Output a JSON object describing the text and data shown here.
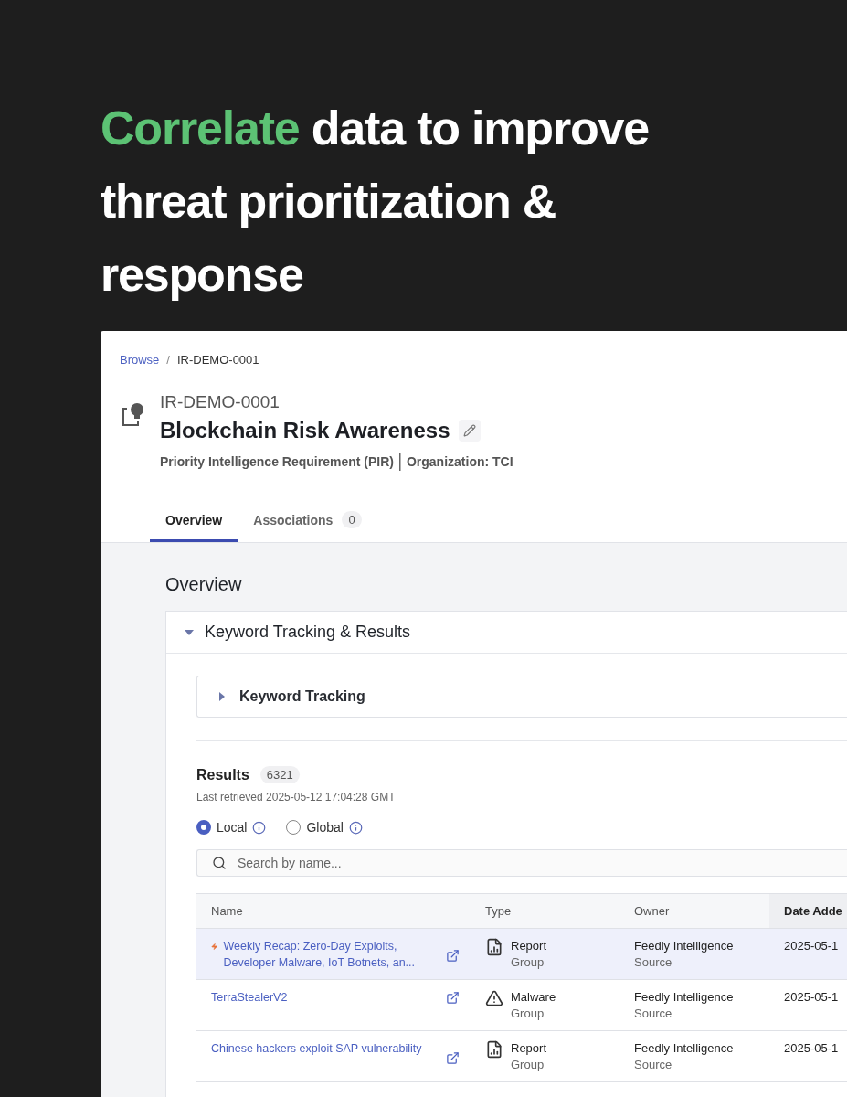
{
  "headline": [
    {
      "text": "Correlate",
      "highlight": true
    },
    {
      "text": "data to improve threat prioritization & response",
      "highlight": false
    }
  ],
  "breadcrumb": {
    "separator": "/",
    "items": [
      {
        "label": "Browse",
        "link": true
      },
      {
        "label": "IR-DEMO-0001",
        "link": false
      }
    ]
  },
  "record": {
    "id": "IR-DEMO-0001",
    "title": "Blockchain Risk Awareness",
    "type": "Priority Intelligence Requirement (PIR)",
    "organization": "Organization: TCI"
  },
  "tabs": [
    {
      "label": "Overview",
      "selected": true
    },
    {
      "label": "Associations",
      "count": "0",
      "selected": false
    }
  ],
  "section_title": "Overview",
  "panel": {
    "title": "Keyword Tracking & Results",
    "expanded": true
  },
  "subpanel": {
    "title": "Keyword Tracking",
    "expanded": false
  },
  "results": {
    "label": "Results",
    "count": "6321",
    "retrieved": "Last retrieved 2025-05-12 17:04:28 GMT"
  },
  "scope": [
    {
      "label": "Local",
      "selected": true
    },
    {
      "label": "Global",
      "selected": false
    }
  ],
  "search": {
    "placeholder": "Search by name..."
  },
  "table": {
    "columns": [
      "Name",
      "Type",
      "Owner",
      "Date Adde"
    ],
    "rows": [
      {
        "name": "Weekly Recap: Zero-Day Exploits, Developer Malware, IoT Botnets, an...",
        "flagged": true,
        "selected": true,
        "kind": "report",
        "type": "Report",
        "type_sub": "Group",
        "owner": "Feedly Intelligence",
        "owner_sub": "Source",
        "date": "2025-05-1"
      },
      {
        "name": "TerraStealerV2",
        "flagged": false,
        "selected": false,
        "kind": "malware",
        "type": "Malware",
        "type_sub": "Group",
        "owner": "Feedly Intelligence",
        "owner_sub": "Source",
        "date": "2025-05-1"
      },
      {
        "name": "Chinese hackers exploit SAP vulnerability",
        "flagged": false,
        "selected": false,
        "kind": "report",
        "type": "Report",
        "type_sub": "Group",
        "owner": "Feedly Intelligence",
        "owner_sub": "Source",
        "date": "2025-05-1"
      }
    ]
  }
}
